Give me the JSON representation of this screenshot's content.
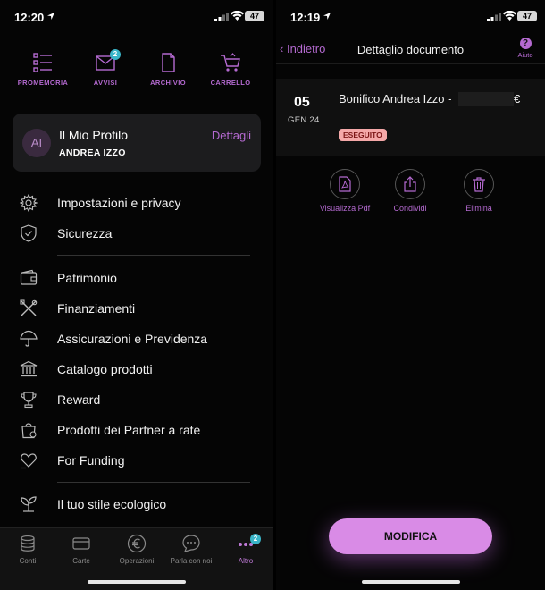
{
  "left": {
    "status": {
      "time": "12:20",
      "battery": "47"
    },
    "shortcuts": [
      {
        "label": "PROMEMORIA",
        "icon": "checklist-icon"
      },
      {
        "label": "AVVISI",
        "icon": "mail-icon",
        "badge": "2"
      },
      {
        "label": "ARCHIVIO",
        "icon": "document-icon"
      },
      {
        "label": "CARRELLO",
        "icon": "cart-icon"
      }
    ],
    "profile": {
      "initials": "AI",
      "title": "Il Mio Profilo",
      "name": "ANDREA IZZO",
      "link": "Dettagli"
    },
    "menu": [
      {
        "label": "Impostazioni e privacy",
        "icon": "gear-icon"
      },
      {
        "label": "Sicurezza",
        "icon": "shield-icon"
      },
      {
        "label": "Patrimonio",
        "icon": "wallet-icon"
      },
      {
        "label": "Finanziamenti",
        "icon": "tools-icon"
      },
      {
        "label": "Assicurazioni e Previdenza",
        "icon": "umbrella-icon"
      },
      {
        "label": "Catalogo prodotti",
        "icon": "bank-icon"
      },
      {
        "label": "Reward",
        "icon": "trophy-icon"
      },
      {
        "label": "Prodotti dei Partner a rate",
        "icon": "bag-icon"
      },
      {
        "label": "For Funding",
        "icon": "heart-icon"
      },
      {
        "label": "Il tuo stile ecologico",
        "icon": "leaf-icon"
      }
    ],
    "tabs": [
      {
        "label": "Conti",
        "icon": "coins-icon"
      },
      {
        "label": "Carte",
        "icon": "card-icon"
      },
      {
        "label": "Operazioni",
        "icon": "euro-icon"
      },
      {
        "label": "Parla con noi",
        "icon": "chat-icon"
      },
      {
        "label": "Altro",
        "icon": "more-icon",
        "badge": "2"
      }
    ]
  },
  "right": {
    "status": {
      "time": "12:19",
      "battery": "47"
    },
    "nav": {
      "back": "Indietro",
      "title": "Dettaglio documento",
      "help": "Aiuto"
    },
    "document": {
      "day": "05",
      "month": "GEN 24",
      "title": "Bonifico Andrea Izzo -",
      "currency": "€",
      "status": "ESEGUITO"
    },
    "actions": [
      {
        "label": "Visualizza Pdf",
        "icon": "pdf-icon"
      },
      {
        "label": "Condividi",
        "icon": "share-icon"
      },
      {
        "label": "Elimina",
        "icon": "trash-icon"
      }
    ],
    "cta": "MODIFICA"
  },
  "colors": {
    "accent": "#b56ad1",
    "cta": "#d98be6",
    "badge": "#3ab5c8",
    "status_bg": "#f4a8a8"
  }
}
